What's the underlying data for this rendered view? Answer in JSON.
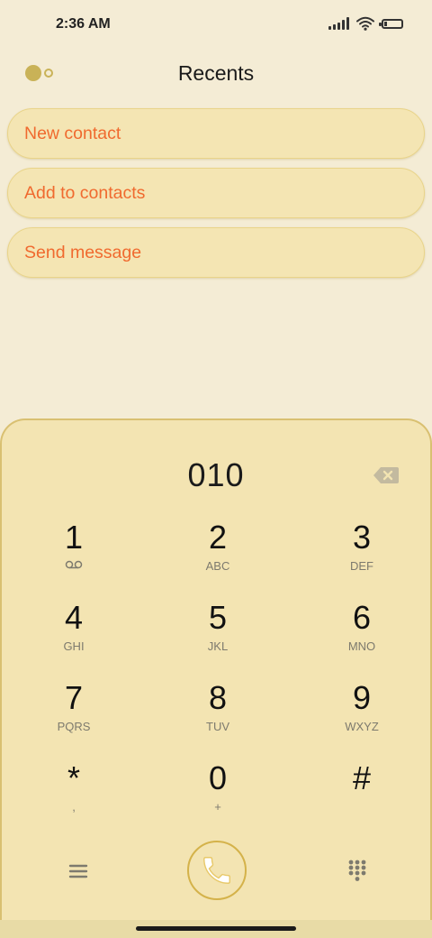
{
  "status_bar": {
    "time": "2:36 AM",
    "icons": [
      "signal-icon",
      "wifi-icon",
      "battery-icon"
    ]
  },
  "header": {
    "title": "Recents",
    "toggle_icon": "toggle-icon"
  },
  "actions": [
    {
      "label": "New contact"
    },
    {
      "label": "Add to contacts"
    },
    {
      "label": "Send message"
    }
  ],
  "dialpad": {
    "number": "010",
    "keys": [
      {
        "digit": "1",
        "letters": ""
      },
      {
        "digit": "2",
        "letters": "ABC"
      },
      {
        "digit": "3",
        "letters": "DEF"
      },
      {
        "digit": "4",
        "letters": "GHI"
      },
      {
        "digit": "5",
        "letters": "JKL"
      },
      {
        "digit": "6",
        "letters": "MNO"
      },
      {
        "digit": "7",
        "letters": "PQRS"
      },
      {
        "digit": "8",
        "letters": "TUV"
      },
      {
        "digit": "9",
        "letters": "WXYZ"
      },
      {
        "digit": "*",
        "letters": ","
      },
      {
        "digit": "0",
        "letters": "+"
      },
      {
        "digit": "#",
        "letters": ""
      }
    ],
    "icons": {
      "backspace": "backspace-icon",
      "voicemail": "voicemail-icon",
      "menu": "menu-icon",
      "call": "phone-icon",
      "keypad": "dialpad-icon"
    }
  },
  "colors": {
    "background": "#f4ecd5",
    "panel": "#f3e4b2",
    "accent": "#f06a2f",
    "call_ring": "#d4b24a"
  }
}
